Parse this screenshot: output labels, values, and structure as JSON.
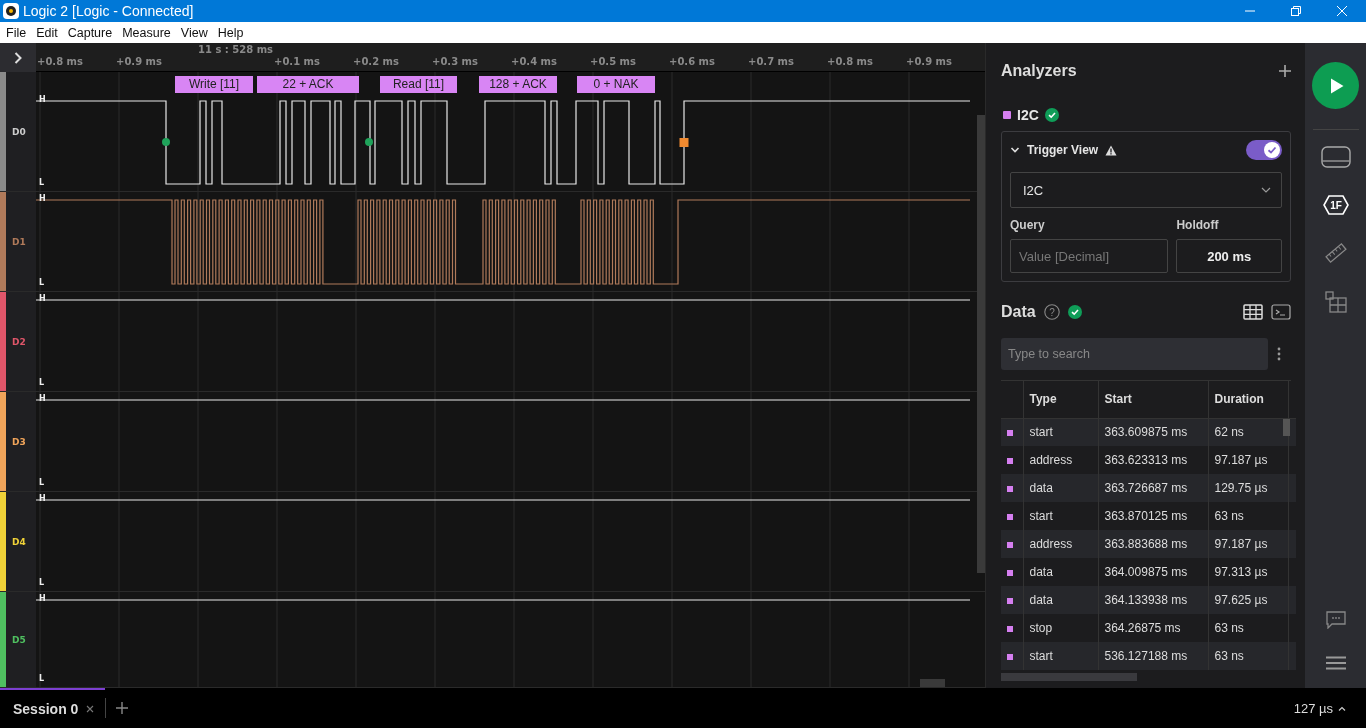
{
  "window": {
    "title": "Logic 2 [Logic - Connected]"
  },
  "menu": [
    "File",
    "Edit",
    "Capture",
    "Measure",
    "View",
    "Help"
  ],
  "timeline": {
    "origin": "11 s : 528 ms",
    "ticks": [
      "+0.8 ms",
      "+0.9 ms",
      "+0.1 ms",
      "+0.2 ms",
      "+0.3 ms",
      "+0.4 ms",
      "+0.5 ms",
      "+0.6 ms",
      "+0.7 ms",
      "+0.8 ms",
      "+0.9 ms"
    ]
  },
  "annotations": [
    "Write [11]",
    "22 + ACK",
    "Read [11]",
    "128 + ACK",
    "0 + NAK"
  ],
  "channels": [
    {
      "name": "D0",
      "color": "#8a8a8a",
      "kind": "sda",
      "high": "H",
      "low": "L"
    },
    {
      "name": "D1",
      "color": "#b07a5a",
      "kind": "scl",
      "high": "H",
      "low": "L"
    },
    {
      "name": "D2",
      "color": "#e0566a",
      "kind": "flat",
      "high": "H",
      "low": "L"
    },
    {
      "name": "D3",
      "color": "#f0a45a",
      "kind": "flat",
      "high": "H",
      "low": "L"
    },
    {
      "name": "D4",
      "color": "#f0d238",
      "kind": "flat",
      "high": "H",
      "low": "L"
    },
    {
      "name": "D5",
      "color": "#4fc060",
      "kind": "flat",
      "high": "H",
      "low": "L"
    }
  ],
  "analyzers": {
    "title": "Analyzers",
    "items": [
      {
        "name": "I2C",
        "color": "#d57ff0",
        "ok": true
      }
    ],
    "trigger": {
      "title": "Trigger View",
      "expanded": true,
      "on": true,
      "select": "I2C",
      "query_label": "Query",
      "query_placeholder": "Value [Decimal]",
      "holdoff_label": "Holdoff",
      "holdoff": "200 ms"
    }
  },
  "rail": {
    "badge": "1F"
  },
  "data": {
    "title": "Data",
    "help": "?",
    "ok": true,
    "search_placeholder": "Type to search",
    "columns": [
      "Type",
      "Start",
      "Duration"
    ],
    "rows": [
      {
        "color": "#d57ff0",
        "cells": [
          "start",
          "363.609875 ms",
          "62 ns"
        ]
      },
      {
        "color": "#d57ff0",
        "cells": [
          "address",
          "363.623313 ms",
          "97.187 µs"
        ]
      },
      {
        "color": "#d57ff0",
        "cells": [
          "data",
          "363.726687 ms",
          "129.75 µs"
        ]
      },
      {
        "color": "#d57ff0",
        "cells": [
          "start",
          "363.870125 ms",
          "63 ns"
        ]
      },
      {
        "color": "#d57ff0",
        "cells": [
          "address",
          "363.883688 ms",
          "97.187 µs"
        ]
      },
      {
        "color": "#d57ff0",
        "cells": [
          "data",
          "364.009875 ms",
          "97.313 µs"
        ]
      },
      {
        "color": "#d57ff0",
        "cells": [
          "data",
          "364.133938 ms",
          "97.625 µs"
        ]
      },
      {
        "color": "#d57ff0",
        "cells": [
          "stop",
          "364.26875 ms",
          "63 ns"
        ]
      },
      {
        "color": "#d57ff0",
        "cells": [
          "start",
          "536.127188 ms",
          "63 ns"
        ]
      }
    ]
  },
  "sessions": [
    {
      "label": "Session 0",
      "selected": true
    }
  ],
  "status": "127 µs"
}
